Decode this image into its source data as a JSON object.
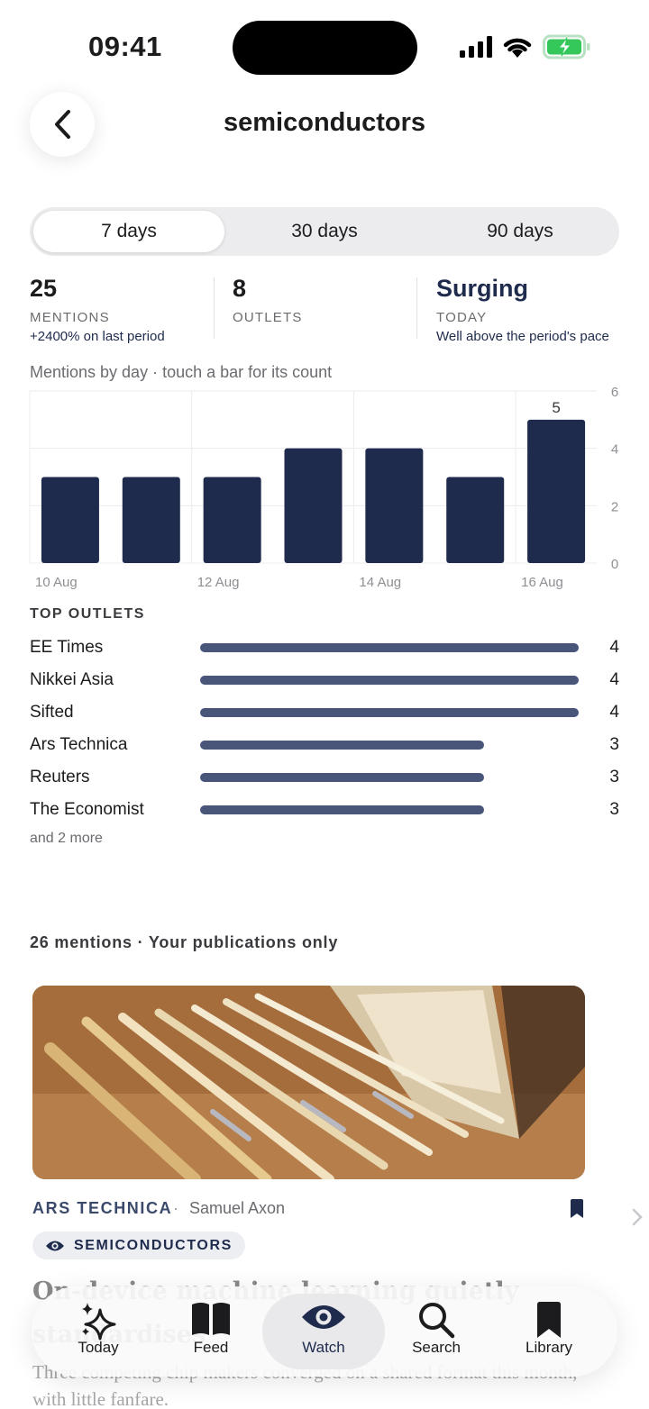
{
  "status_bar": {
    "time": "09:41"
  },
  "header": {
    "title": "semiconductors"
  },
  "period_tabs": [
    {
      "label": "7 days",
      "active": true
    },
    {
      "label": "30 days",
      "active": false
    },
    {
      "label": "90 days",
      "active": false
    }
  ],
  "stats": {
    "mentions": {
      "value": "25",
      "label": "MENTIONS",
      "sub": "+2400% on last period"
    },
    "outlets": {
      "value": "8",
      "label": "OUTLETS"
    },
    "trend": {
      "value": "Surging",
      "label": "TODAY",
      "sub": "Well above the period's pace"
    }
  },
  "chart_caption": "Mentions by day · touch a bar for its count",
  "chart_data": {
    "type": "bar",
    "categories": [
      "10 Aug",
      "11 Aug",
      "12 Aug",
      "13 Aug",
      "14 Aug",
      "15 Aug",
      "16 Aug"
    ],
    "values": [
      3,
      3,
      3,
      4,
      4,
      3,
      5
    ],
    "x_tick_labels": [
      "10 Aug",
      "12 Aug",
      "14 Aug",
      "16 Aug"
    ],
    "y_ticks": [
      "0",
      "2",
      "4",
      "6"
    ],
    "ylim": [
      0,
      6
    ],
    "highlighted_label": "5",
    "bar_color": "#1f2b4d",
    "grid": true
  },
  "top_outlets": {
    "heading": "TOP OUTLETS",
    "items": [
      {
        "name": "EE Times",
        "count": "4",
        "share": 1.0
      },
      {
        "name": "Nikkei Asia",
        "count": "4",
        "share": 1.0
      },
      {
        "name": "Sifted",
        "count": "4",
        "share": 1.0
      },
      {
        "name": "Ars Technica",
        "count": "3",
        "share": 0.75
      },
      {
        "name": "Reuters",
        "count": "3",
        "share": 0.75
      },
      {
        "name": "The Economist",
        "count": "3",
        "share": 0.75
      }
    ],
    "more": "and 2 more"
  },
  "mentions_heading": "26 mentions · Your publications only",
  "article": {
    "source": "ARS TECHNICA",
    "separator": "·",
    "author": "Samuel Axon",
    "tag": "SEMICONDUCTORS",
    "headline": "On-device machine learning quietly standardises",
    "excerpt": "Three competing chip makers converged on a shared format this month, with little fanfare."
  },
  "tabbar": [
    {
      "label": "Today",
      "icon": "sparkles-icon",
      "active": false
    },
    {
      "label": "Feed",
      "icon": "book-icon",
      "active": false
    },
    {
      "label": "Watch",
      "icon": "eye-icon",
      "active": true
    },
    {
      "label": "Search",
      "icon": "magnifier-icon",
      "active": false
    },
    {
      "label": "Library",
      "icon": "bookmark-icon",
      "active": false
    }
  ],
  "colors": {
    "accent": "#1f2b4d",
    "outlet_bar": "#495679",
    "battery_green": "#34c759"
  }
}
